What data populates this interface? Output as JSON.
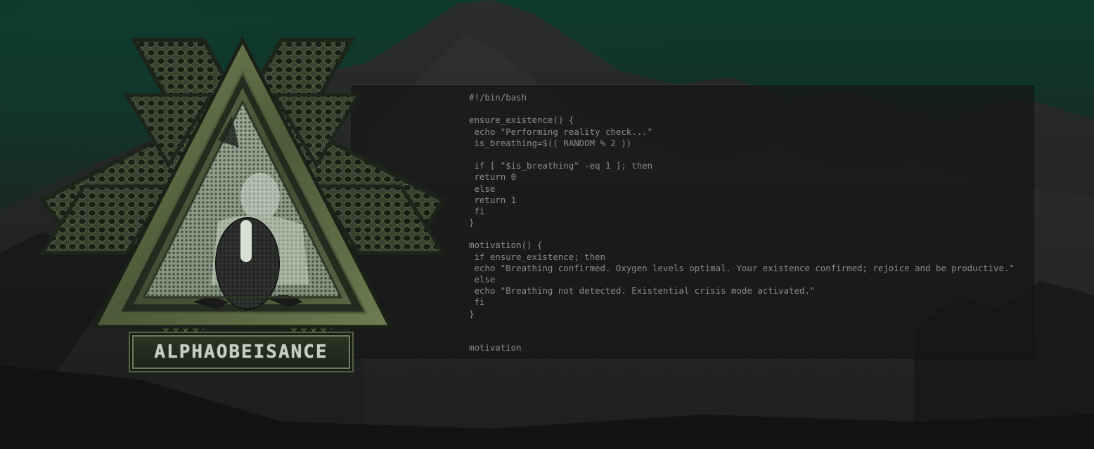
{
  "brand": {
    "name": "ALPHAOBEISANCE"
  },
  "terminal": {
    "lines": [
      "#!/bin/bash",
      "",
      "ensure_existence() {",
      " echo \"Performing reality check...\"",
      " is_breathing=$(( RANDOM % 2 ))",
      "",
      " if [ \"$is_breathing\" -eq 1 ]; then",
      " return 0",
      " else",
      " return 1",
      " fi",
      "}",
      "",
      "motivation() {",
      " if ensure_existence; then",
      " echo \"Breathing confirmed. Oxygen levels optimal. Your existence confirmed; rejoice and be productive.\"",
      " else",
      " echo \"Breathing not detected. Existential crisis mode activated.\"",
      " fi",
      "}",
      "",
      "",
      "motivation"
    ]
  },
  "colors": {
    "sky_top": "#0d3a2c",
    "terminal_text": "#8b8b8b",
    "logo_green": "#6e7d52"
  }
}
